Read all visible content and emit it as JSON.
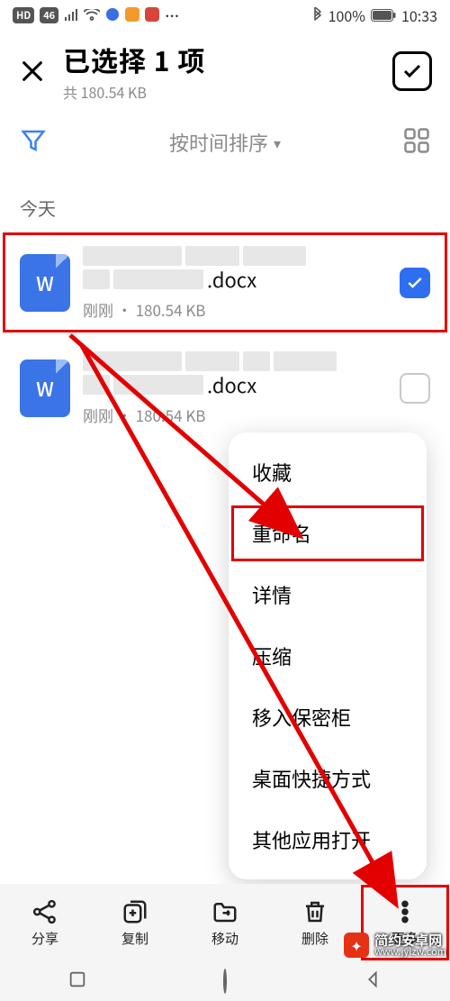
{
  "status": {
    "hd_badge": "HD",
    "net_badge": "46",
    "bluetooth_icon": "bluetooth",
    "battery_pct": "100%",
    "time": "10:33"
  },
  "header": {
    "title": "已选择 1 项",
    "subtitle": "共 180.54 KB"
  },
  "sort": {
    "label": "按时间排序"
  },
  "section": {
    "today": "今天"
  },
  "files": [
    {
      "icon_letter": "W",
      "ext": ".docx",
      "meta": "刚刚 · 180.54 KB",
      "checked": true,
      "highlighted": true
    },
    {
      "icon_letter": "W",
      "ext": ".docx",
      "meta": "刚刚 · 180.54 KB",
      "checked": false,
      "highlighted": false
    }
  ],
  "popup": {
    "items": [
      {
        "label": "收藏",
        "highlighted": false
      },
      {
        "label": "重命名",
        "highlighted": true
      },
      {
        "label": "详情",
        "highlighted": false
      },
      {
        "label": "压缩",
        "highlighted": false
      },
      {
        "label": "移入保密柜",
        "highlighted": false
      },
      {
        "label": "桌面快捷方式",
        "highlighted": false
      },
      {
        "label": "其他应用打开",
        "highlighted": false
      }
    ]
  },
  "bottom": {
    "share": "分享",
    "copy": "复制",
    "move": "移动",
    "delete": "删除",
    "more": "更多"
  },
  "watermark": {
    "cn": "简约安卓网",
    "url": "www.jylzw.com"
  }
}
